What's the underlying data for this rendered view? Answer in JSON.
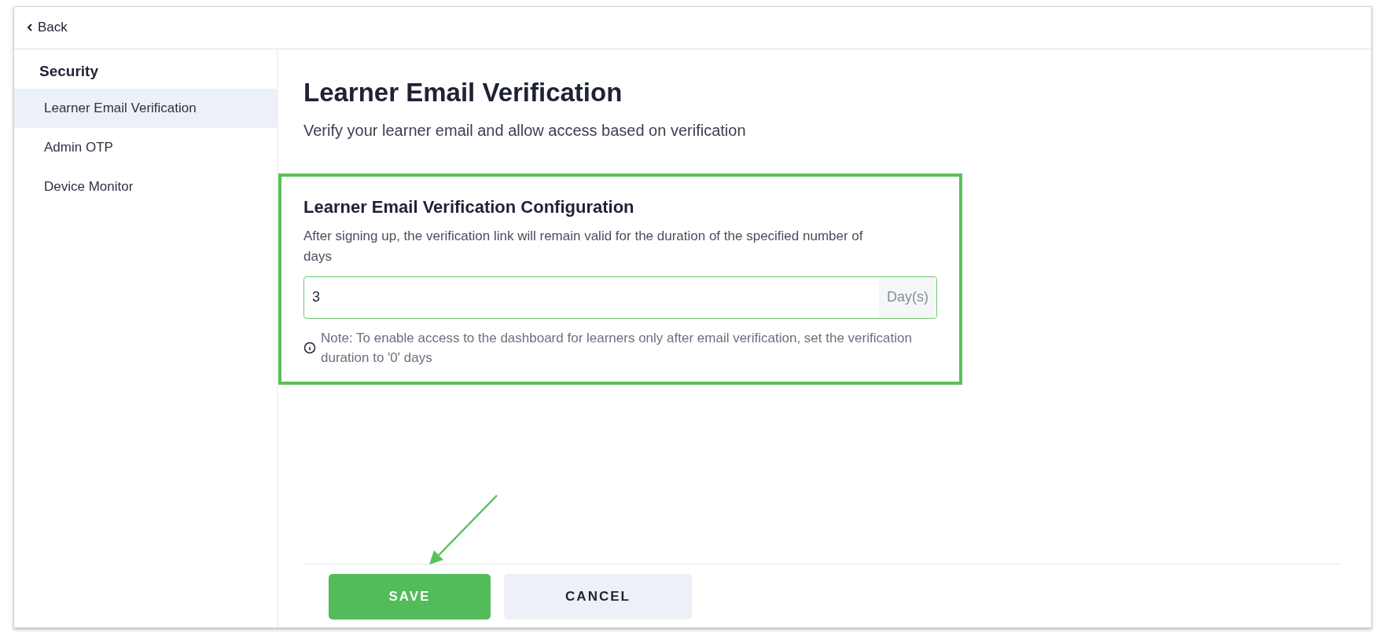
{
  "top_bar": {
    "back_label": "Back"
  },
  "sidebar": {
    "title": "Security",
    "items": [
      {
        "label": "Learner Email Verification",
        "selected": true
      },
      {
        "label": "Admin OTP",
        "selected": false
      },
      {
        "label": "Device Monitor",
        "selected": false
      }
    ]
  },
  "page": {
    "title": "Learner Email Verification",
    "subtitle": "Verify your learner email and allow access based on verification"
  },
  "config": {
    "highlighted": true,
    "title": "Learner Email Verification Configuration",
    "description": "After signing up, the verification link will remain valid for the duration of the specified number of days",
    "field": {
      "value": "3",
      "suffix": "Day(s)"
    },
    "note": "Note: To enable access to the dashboard for learners only after email verification, set the verification duration to '0' days"
  },
  "annotation_arrow": true,
  "buttons": [
    {
      "label": "SAVE",
      "kind": "primary"
    },
    {
      "label": "CANCEL",
      "kind": "secondary"
    }
  ]
}
